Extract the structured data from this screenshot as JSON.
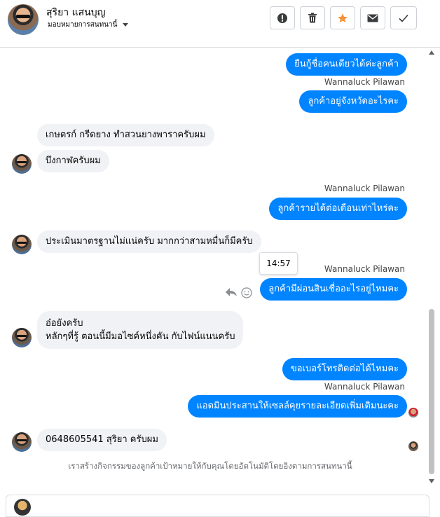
{
  "header": {
    "name": "สุริยา แสนบุญ",
    "subtitle": "มอบหมายการสนทนานี้"
  },
  "toolbar": {
    "buttons": [
      {
        "icon": "alert-icon"
      },
      {
        "icon": "trash-icon"
      },
      {
        "icon": "star-icon",
        "color": "#f7923a"
      },
      {
        "icon": "mail-icon"
      },
      {
        "icon": "check-icon"
      }
    ]
  },
  "messages": [
    {
      "dir": "out",
      "text": "ยืนกู้ชื่อคนเดียวได้ค่ะลูกค้า"
    },
    {
      "dir": "sender",
      "text": "Wannaluck Pilawan"
    },
    {
      "dir": "out",
      "text": "ลูกค้าอยู่จังหวัดอะไรคะ"
    },
    {
      "dir": "in",
      "text": "เกษตรก์ กรีดยาง  ทำสวนยางพาราครับผม"
    },
    {
      "dir": "in",
      "text": "บึงกาฬครับผม"
    },
    {
      "dir": "sender",
      "text": "Wannaluck Pilawan"
    },
    {
      "dir": "out",
      "text": "ลูกค้ารายได้ต่อเดือนเท่าไหร่คะ"
    },
    {
      "dir": "in",
      "text": "ประเมินมาตรฐานไม่แน่ครับ มากกว่าสามหมื่นก็มีครับ"
    },
    {
      "dir": "tooltip",
      "text": "14:57"
    },
    {
      "dir": "sender",
      "text": "Wannaluck Pilawan"
    },
    {
      "dir": "out",
      "text": "ลูกค้ามีผ่อนสินเชื่ออะไรอยู่ไหมคะ"
    },
    {
      "dir": "in",
      "line1": "อ๋อยังครับ",
      "line2": "หลักๆที่รู้ ตอนนี้มีมอไซค์หนึ่งคัน กับไฟน์แนนครับ"
    },
    {
      "dir": "out",
      "text": "ขอเบอร์โทรติดต่อได้ไหมคะ"
    },
    {
      "dir": "sender",
      "text": "Wannaluck Pilawan"
    },
    {
      "dir": "out",
      "text": "แอดมินประสานให้เซลล์คุยรายละเอียดเพิ่มเติมนะคะ"
    },
    {
      "dir": "in",
      "text": "0648605541 สุริยา ครับผม"
    }
  ],
  "notice": "เราสร้างกิจกรรมของลูกค้าเป้าหมายให้กับคุณโดยอัตโนมัติโดยอิงตามการสนทนานี้",
  "colors": {
    "outgoing": "#0084ff",
    "incoming": "#f0f2f5",
    "star": "#f7923a"
  }
}
